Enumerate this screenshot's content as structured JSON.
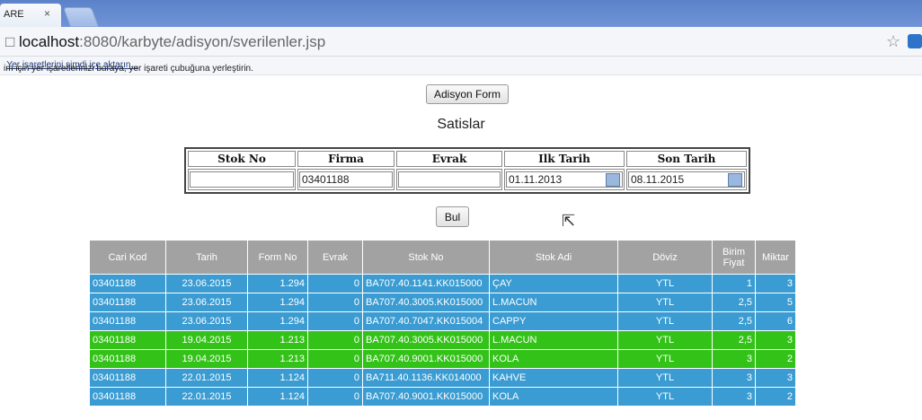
{
  "browser": {
    "tab_title": "ARE",
    "tab_close": "×",
    "url_host": "localhost",
    "url_path": ":8080/karbyte/adisyon/sverilenler.jsp",
    "bookmarks_text": "im için yer işaretlerinizi buraya, yer işareti çubuğuna yerleştirin.",
    "bookmarks_link": "Yer işaretlerini şimdi içe aktarın..."
  },
  "page": {
    "form_button": "Adisyon Form",
    "title": "Satislar",
    "search_button": "Bul"
  },
  "filter": {
    "headers": [
      "Stok No",
      "Firma",
      "Evrak",
      "Ilk Tarih",
      "Son Tarih"
    ],
    "stok_no": "",
    "firma": "03401188",
    "evrak": "",
    "ilk_tarih": "01.11.2013",
    "son_tarih": "08.11.2015"
  },
  "table": {
    "headers": [
      "Cari Kod",
      "Tarih",
      "Form No",
      "Evrak",
      "Stok No",
      "Stok Adi",
      "Döviz",
      "Birim\nFiyat",
      "Miktar"
    ],
    "row_colors": {
      "blue": "#3a9cd2",
      "green": "#33c218"
    },
    "rows": [
      {
        "color": "blue",
        "cells": [
          "03401188",
          "23.06.2015",
          "1.294",
          "0",
          "BA707.40.1141.KK015000",
          "ÇAY",
          "YTL",
          "1",
          "3"
        ]
      },
      {
        "color": "blue",
        "cells": [
          "03401188",
          "23.06.2015",
          "1.294",
          "0",
          "BA707.40.3005.KK015000",
          "L.MACUN",
          "YTL",
          "2,5",
          "5"
        ]
      },
      {
        "color": "blue",
        "cells": [
          "03401188",
          "23.06.2015",
          "1.294",
          "0",
          "BA707.40.7047.KK015004",
          "CAPPY",
          "YTL",
          "2,5",
          "6"
        ]
      },
      {
        "color": "green",
        "cells": [
          "03401188",
          "19.04.2015",
          "1.213",
          "0",
          "BA707.40.3005.KK015000",
          "L.MACUN",
          "YTL",
          "2,5",
          "3"
        ]
      },
      {
        "color": "green",
        "cells": [
          "03401188",
          "19.04.2015",
          "1.213",
          "0",
          "BA707.40.9001.KK015000",
          "KOLA",
          "YTL",
          "3",
          "2"
        ]
      },
      {
        "color": "blue",
        "cells": [
          "03401188",
          "22.01.2015",
          "1.124",
          "0",
          "BA711.40.1136.KK014000",
          "KAHVE",
          "YTL",
          "3",
          "3"
        ]
      },
      {
        "color": "blue",
        "cells": [
          "03401188",
          "22.01.2015",
          "1.124",
          "0",
          "BA707.40.9001.KK015000",
          "KOLA",
          "YTL",
          "3",
          "2"
        ]
      }
    ]
  }
}
